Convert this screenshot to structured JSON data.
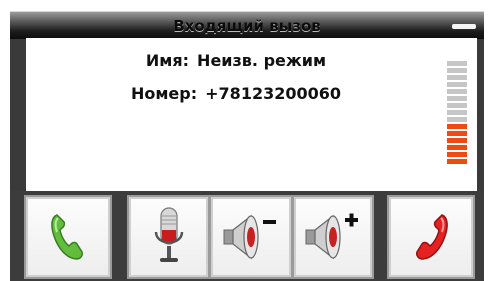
{
  "window": {
    "title": "Входящий вызов"
  },
  "caller": {
    "name_label": "Имя:",
    "name_value": "Неизв. режим",
    "number_label": "Номер:",
    "number_value": "+78123200060"
  },
  "signal_level": {
    "active_segments": 6,
    "total_segments": 15
  },
  "buttons": [
    {
      "name": "answer-button",
      "icon": "phone-answer-icon",
      "color": "#59b534"
    },
    {
      "name": "microphone-button",
      "icon": "microphone-icon"
    },
    {
      "name": "volume-down-button",
      "icon": "speaker-minus-icon"
    },
    {
      "name": "volume-up-button",
      "icon": "speaker-plus-icon"
    },
    {
      "name": "reject-button",
      "icon": "phone-reject-icon",
      "color": "#e21f1f"
    }
  ]
}
